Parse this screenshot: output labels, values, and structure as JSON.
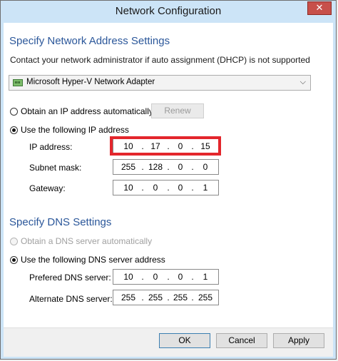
{
  "window": {
    "title": "Network Configuration",
    "close_glyph": "✕"
  },
  "address_section": {
    "title": "Specify Network Address Settings",
    "info": "Contact your network administrator if auto assignment (DHCP) is not supported",
    "adapter": "Microsoft Hyper-V Network Adapter",
    "auto_label": "Obtain an IP address automatically",
    "renew_label": "Renew",
    "manual_label": "Use the following IP address",
    "selected": "manual",
    "fields": [
      {
        "label": "IP address:",
        "octets": [
          "10",
          "17",
          "0",
          "15"
        ]
      },
      {
        "label": "Subnet mask:",
        "octets": [
          "255",
          "128",
          "0",
          "0"
        ]
      },
      {
        "label": "Gateway:",
        "octets": [
          "10",
          "0",
          "0",
          "1"
        ]
      }
    ]
  },
  "dns_section": {
    "title": "Specify DNS Settings",
    "auto_label": "Obtain a DNS server automatically",
    "manual_label": "Use the following DNS server address",
    "selected": "manual",
    "fields": [
      {
        "label": "Prefered DNS server:",
        "octets": [
          "10",
          "0",
          "0",
          "1"
        ]
      },
      {
        "label": "Alternate DNS server:",
        "octets": [
          "255",
          "255",
          "255",
          "255"
        ]
      }
    ]
  },
  "footer": {
    "ok_label": "OK",
    "cancel_label": "Cancel",
    "apply_label": "Apply"
  },
  "colors": {
    "section_title": "#2b579a",
    "highlight": "#e3262c",
    "titlebar": "#cce4f7"
  }
}
